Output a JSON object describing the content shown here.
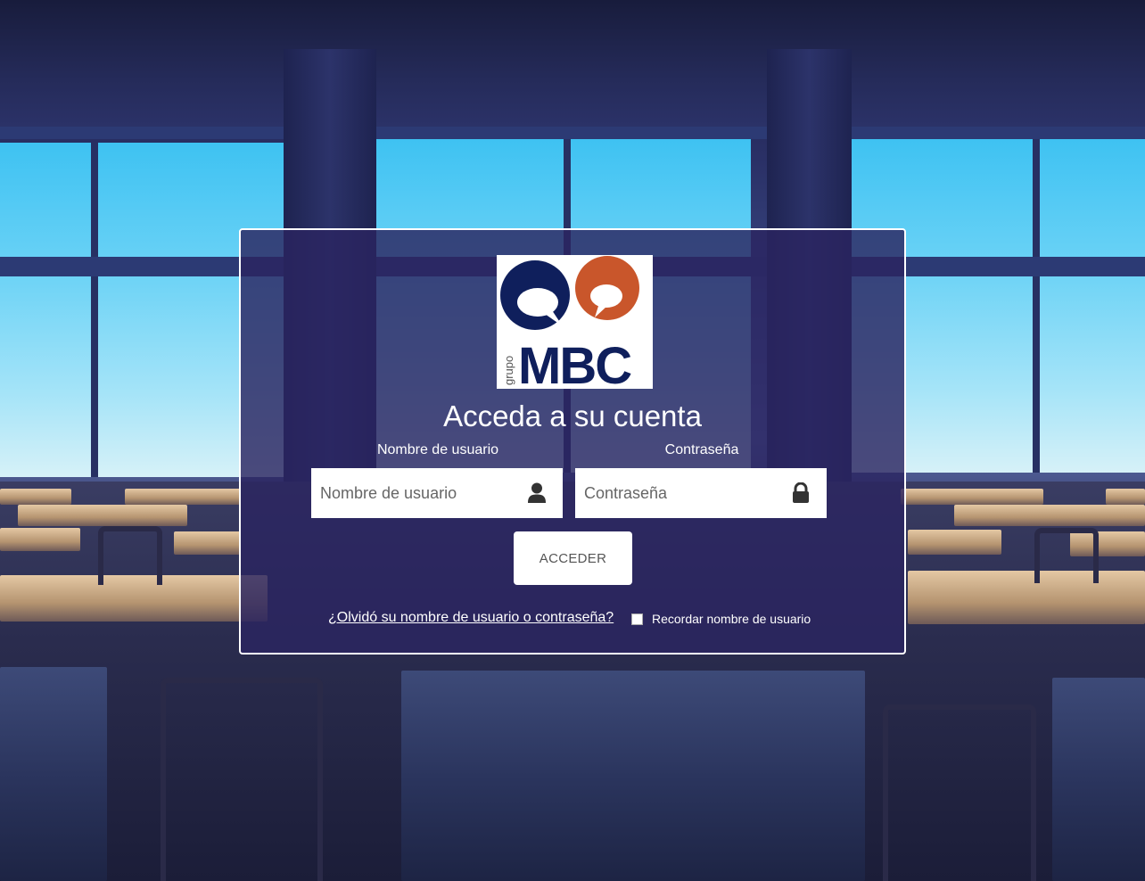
{
  "logo": {
    "small_text": "grupo",
    "big_text": "MBC",
    "colors": {
      "navy": "#0f1f5c",
      "orange": "#c9562b"
    }
  },
  "login": {
    "title": "Acceda a su cuenta",
    "username_label": "Nombre de usuario",
    "username_placeholder": "Nombre de usuario",
    "username_icon": "user-icon",
    "password_label": "Contraseña",
    "password_placeholder": "Contraseña",
    "password_icon": "lock-icon",
    "submit_label": "ACCEDER",
    "forgot_link": "¿Olvidó su nombre de usuario o contraseña?",
    "remember_label": "Recordar nombre de usuario",
    "remember_checked": false
  },
  "colors": {
    "overlay": "#2b2460",
    "field_bg": "#ffffff",
    "text": "#ffffff"
  }
}
